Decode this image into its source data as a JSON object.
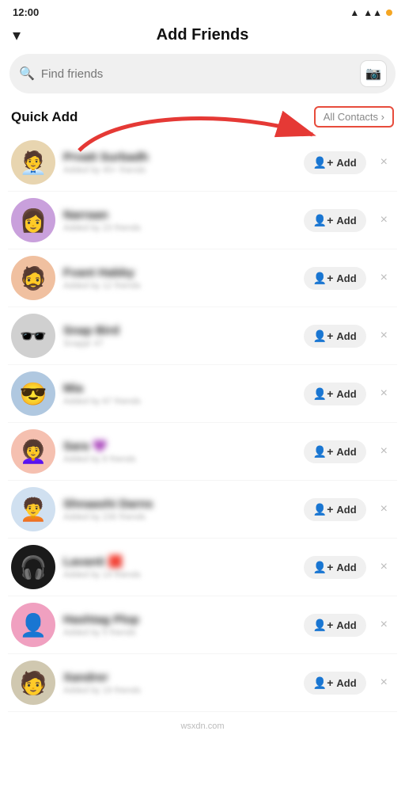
{
  "statusBar": {
    "time": "12:00",
    "batteryColor": "#f5a623"
  },
  "header": {
    "chevronLabel": "▾",
    "title": "Add Friends"
  },
  "searchBar": {
    "placeholder": "Find friends",
    "cameraIcon": "📷"
  },
  "quickAdd": {
    "sectionTitle": "Quick Add",
    "allContactsLabel": "All Contacts ›"
  },
  "friends": [
    {
      "name": "Prvatt Surbadh",
      "sub": "Added by 45+ friends",
      "avatarEmoji": "🧑‍💼",
      "avClass": "av-1"
    },
    {
      "name": "Narraan",
      "sub": "Added by 23 friends",
      "avatarEmoji": "👩",
      "avClass": "av-2"
    },
    {
      "name": "Fvant Habby",
      "sub": "Added by 12 friends",
      "avatarEmoji": "🧔",
      "avClass": "av-3"
    },
    {
      "name": "Snap Bird",
      "sub": "Snappr 47",
      "avatarEmoji": "🕶️",
      "avClass": "av-4"
    },
    {
      "name": "Mia",
      "sub": "Added by 67 friends",
      "avatarEmoji": "😎",
      "avClass": "av-5"
    },
    {
      "name": "Sara 💜",
      "sub": "Added by 8 friends",
      "avatarEmoji": "👩‍🦱",
      "avClass": "av-6"
    },
    {
      "name": "Shnaashi Darns",
      "sub": "Added by 230 friends",
      "avatarEmoji": "🧑‍🦱",
      "avClass": "av-7"
    },
    {
      "name": "Lavanti 🟥",
      "sub": "Added by 14 friends",
      "avatarEmoji": "🎧",
      "avClass": "av-8"
    },
    {
      "name": "Hashtag Plop",
      "sub": "Added by 5 friends",
      "avatarEmoji": "👤",
      "avClass": "av-9"
    },
    {
      "name": "Xandrer",
      "sub": "Added by 19 friends",
      "avatarEmoji": "🧑",
      "avClass": "av-10"
    }
  ],
  "addButton": {
    "icon": "👤+",
    "label": "Add"
  },
  "watermark": "wsxdn.com"
}
